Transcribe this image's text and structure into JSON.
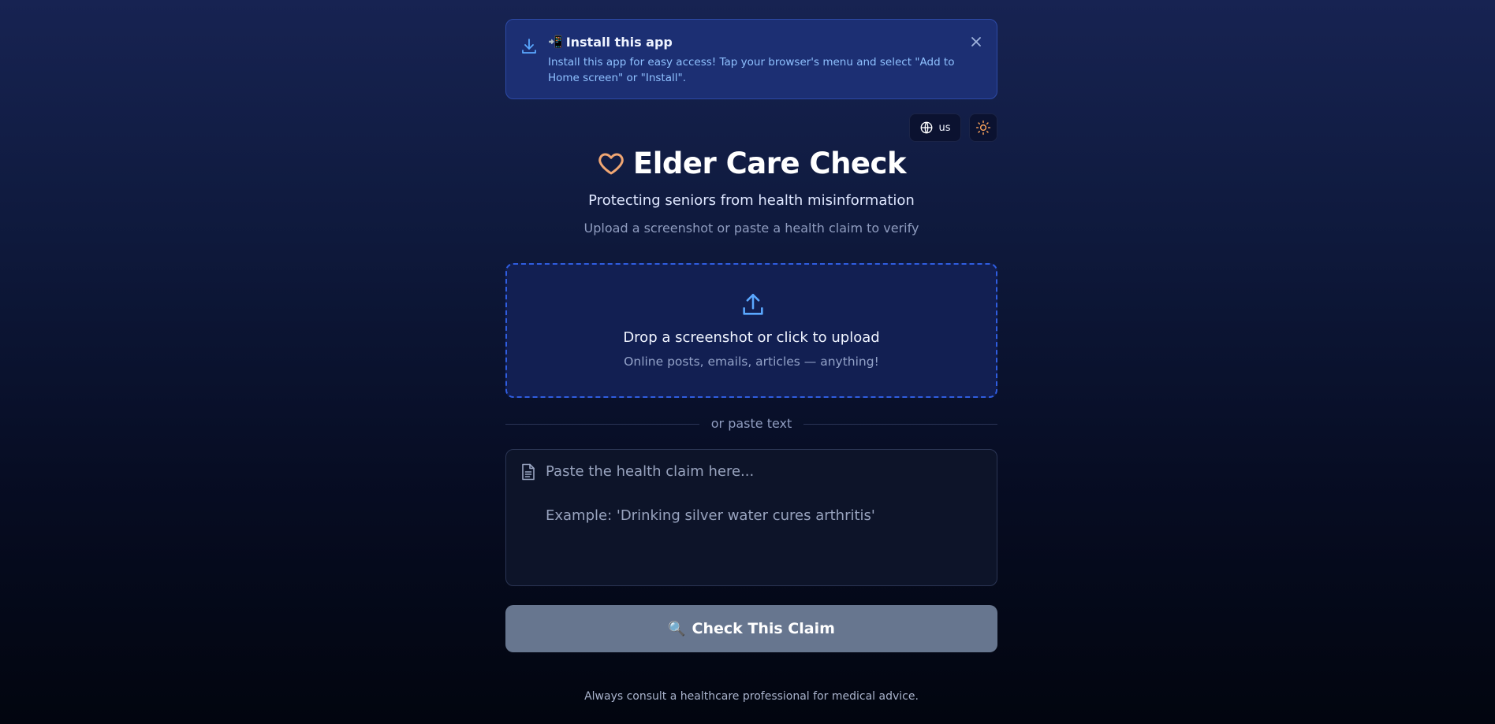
{
  "banner": {
    "title": "Install this app",
    "phone_glyph": "📲",
    "message": "Install this app for easy access! Tap your browser's menu and select \"Add to Home screen\" or \"Install\".",
    "icon": "download-icon",
    "close_icon": "close-icon"
  },
  "controls": {
    "language_label": "us",
    "language_icon": "globe-icon",
    "theme_icon": "sun-icon"
  },
  "header": {
    "title": "Elder Care Check",
    "icon": "heart-icon",
    "subtitle": "Protecting seniors from health misinformation",
    "hint": "Upload a screenshot or paste a health claim to verify"
  },
  "upload": {
    "title": "Drop a screenshot or click to upload",
    "subtitle": "Online posts, emails, articles — anything!",
    "icon": "upload-icon"
  },
  "divider": {
    "label": "or paste text"
  },
  "claim_input": {
    "value": "",
    "placeholder": "Paste the health claim here...\n\nExample: 'Drinking silver water cures arthritis'",
    "icon": "document-icon"
  },
  "check_button": {
    "glyph": "🔍",
    "label": "Check This Claim"
  },
  "footer": {
    "text": "Always consult a healthcare professional for medical advice."
  },
  "colors": {
    "accent": "#2f5de0",
    "banner_text": "#8fc1ff",
    "heart": "#f0a673",
    "sun": "#f5a05a",
    "button_disabled": "#67768f"
  }
}
